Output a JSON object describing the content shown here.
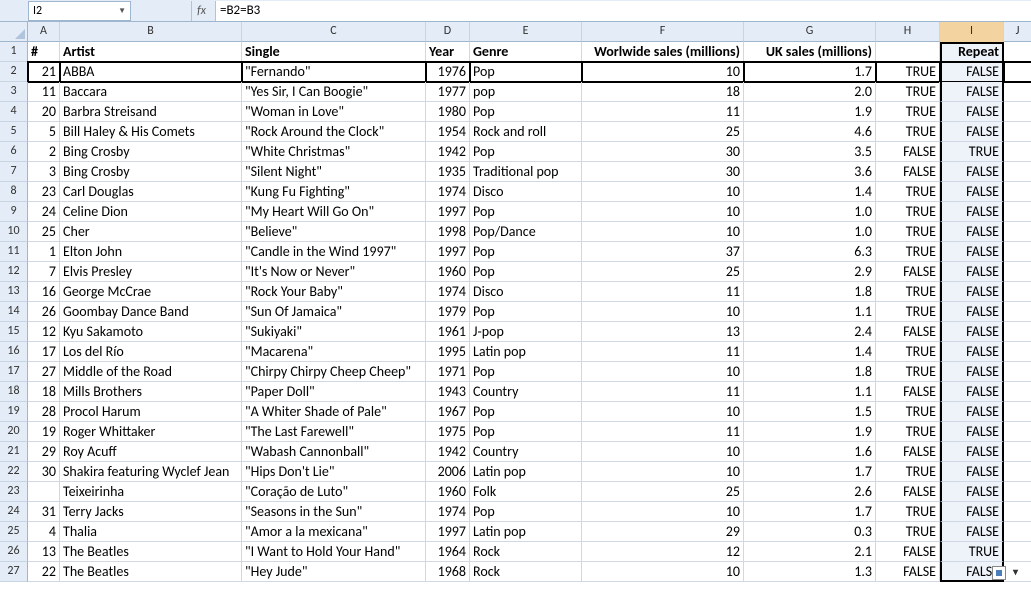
{
  "formula_bar": {
    "name_box": "I2",
    "formula": "=B2=B3"
  },
  "columns": [
    {
      "letter": "A",
      "cls": "col-A"
    },
    {
      "letter": "B",
      "cls": "col-B"
    },
    {
      "letter": "C",
      "cls": "col-C"
    },
    {
      "letter": "D",
      "cls": "col-D"
    },
    {
      "letter": "E",
      "cls": "col-E"
    },
    {
      "letter": "F",
      "cls": "col-F"
    },
    {
      "letter": "G",
      "cls": "col-G"
    },
    {
      "letter": "H",
      "cls": "col-H"
    },
    {
      "letter": "I",
      "cls": "col-I",
      "selected": true
    },
    {
      "letter": "J",
      "cls": "col-J"
    }
  ],
  "headers": {
    "A": "#",
    "B": "Artist",
    "C": "Single",
    "D": "Year",
    "E": "Genre",
    "F": "Worlwide sales (millions)",
    "G": "UK sales (millions)",
    "H": "",
    "I": "Repeat"
  },
  "active_cell": "I2",
  "selected_column": "I",
  "rows": [
    {
      "n": 2,
      "A": "21",
      "B": "ABBA",
      "C": "\"Fernando\"",
      "D": "1976",
      "E": "Pop",
      "F": "10",
      "G": "1.7",
      "H": "TRUE",
      "I": "FALSE"
    },
    {
      "n": 3,
      "A": "11",
      "B": "Baccara",
      "C": "\"Yes Sir, I Can Boogie\"",
      "D": "1977",
      "E": "pop",
      "F": "18",
      "G": "2.0",
      "H": "TRUE",
      "I": "FALSE"
    },
    {
      "n": 4,
      "A": "20",
      "B": "Barbra Streisand",
      "C": "\"Woman in Love\"",
      "D": "1980",
      "E": "Pop",
      "F": "11",
      "G": "1.9",
      "H": "TRUE",
      "I": "FALSE"
    },
    {
      "n": 5,
      "A": "5",
      "B": "Bill Haley & His Comets",
      "C": "\"Rock Around the Clock\"",
      "D": "1954",
      "E": "Rock and roll",
      "F": "25",
      "G": "4.6",
      "H": "TRUE",
      "I": "FALSE"
    },
    {
      "n": 6,
      "A": "2",
      "B": "Bing Crosby",
      "C": "\"White Christmas\"",
      "D": "1942",
      "E": "Pop",
      "F": "30",
      "G": "3.5",
      "H": "FALSE",
      "I": "TRUE"
    },
    {
      "n": 7,
      "A": "3",
      "B": "Bing Crosby",
      "C": "\"Silent Night\"",
      "D": "1935",
      "E": "Traditional pop",
      "F": "30",
      "G": "3.6",
      "H": "FALSE",
      "I": "FALSE"
    },
    {
      "n": 8,
      "A": "23",
      "B": "Carl Douglas",
      "C": "\"Kung Fu Fighting\"",
      "D": "1974",
      "E": "Disco",
      "F": "10",
      "G": "1.4",
      "H": "TRUE",
      "I": "FALSE"
    },
    {
      "n": 9,
      "A": "24",
      "B": "Celine Dion",
      "C": "\"My Heart Will Go On\"",
      "D": "1997",
      "E": "Pop",
      "F": "10",
      "G": "1.0",
      "H": "TRUE",
      "I": "FALSE"
    },
    {
      "n": 10,
      "A": "25",
      "B": "Cher",
      "C": "\"Believe\"",
      "D": "1998",
      "E": "Pop/Dance",
      "F": "10",
      "G": "1.0",
      "H": "TRUE",
      "I": "FALSE"
    },
    {
      "n": 11,
      "A": "1",
      "B": "Elton John",
      "C": "\"Candle in the Wind 1997\"",
      "D": "1997",
      "E": "Pop",
      "F": "37",
      "G": "6.3",
      "H": "TRUE",
      "I": "FALSE"
    },
    {
      "n": 12,
      "A": "7",
      "B": "Elvis Presley",
      "C": "\"It's Now or Never\"",
      "D": "1960",
      "E": "Pop",
      "F": "25",
      "G": "2.9",
      "H": "FALSE",
      "I": "FALSE"
    },
    {
      "n": 13,
      "A": "16",
      "B": "George McCrae",
      "C": "\"Rock Your Baby\"",
      "D": "1974",
      "E": "Disco",
      "F": "11",
      "G": "1.8",
      "H": "TRUE",
      "I": "FALSE"
    },
    {
      "n": 14,
      "A": "26",
      "B": "Goombay Dance Band",
      "C": "\"Sun Of Jamaica\"",
      "D": "1979",
      "E": "Pop",
      "F": "10",
      "G": "1.1",
      "H": "TRUE",
      "I": "FALSE"
    },
    {
      "n": 15,
      "A": "12",
      "B": "Kyu Sakamoto",
      "C": "\"Sukiyaki\"",
      "D": "1961",
      "E": "J-pop",
      "F": "13",
      "G": "2.4",
      "H": "FALSE",
      "I": "FALSE"
    },
    {
      "n": 16,
      "A": "17",
      "B": "Los del Río",
      "C": "\"Macarena\"",
      "D": "1995",
      "E": "Latin pop",
      "F": "11",
      "G": "1.4",
      "H": "TRUE",
      "I": "FALSE"
    },
    {
      "n": 17,
      "A": "27",
      "B": "Middle of the Road",
      "C": "\"Chirpy Chirpy Cheep Cheep\"",
      "D": "1971",
      "E": "Pop",
      "F": "10",
      "G": "1.8",
      "H": "TRUE",
      "I": "FALSE"
    },
    {
      "n": 18,
      "A": "18",
      "B": "Mills Brothers",
      "C": "\"Paper Doll\"",
      "D": "1943",
      "E": "Country",
      "F": "11",
      "G": "1.1",
      "H": "FALSE",
      "I": "FALSE"
    },
    {
      "n": 19,
      "A": "28",
      "B": "Procol Harum",
      "C": "\"A Whiter Shade of Pale\"",
      "D": "1967",
      "E": "Pop",
      "F": "10",
      "G": "1.5",
      "H": "TRUE",
      "I": "FALSE"
    },
    {
      "n": 20,
      "A": "19",
      "B": "Roger Whittaker",
      "C": "\"The Last Farewell\"",
      "D": "1975",
      "E": "Pop",
      "F": "11",
      "G": "1.9",
      "H": "TRUE",
      "I": "FALSE"
    },
    {
      "n": 21,
      "A": "29",
      "B": "Roy Acuff",
      "C": "\"Wabash Cannonball\"",
      "D": "1942",
      "E": "Country",
      "F": "10",
      "G": "1.6",
      "H": "FALSE",
      "I": "FALSE"
    },
    {
      "n": 22,
      "A": "30",
      "B": "Shakira featuring Wyclef Jean",
      "C": "\"Hips Don't Lie\"",
      "D": "2006",
      "E": "Latin pop",
      "F": "10",
      "G": "1.7",
      "H": "TRUE",
      "I": "FALSE"
    },
    {
      "n": 23,
      "A": "",
      "B": "Teixeirinha",
      "C": "\"Coração de Luto\"",
      "D": "1960",
      "E": "Folk",
      "F": "25",
      "G": "2.6",
      "H": "FALSE",
      "I": "FALSE"
    },
    {
      "n": 24,
      "A": "31",
      "B": "Terry Jacks",
      "C": "\"Seasons in the Sun\"",
      "D": "1974",
      "E": "Pop",
      "F": "10",
      "G": "1.7",
      "H": "TRUE",
      "I": "FALSE"
    },
    {
      "n": 25,
      "A": "4",
      "B": "Thalia",
      "C": "\"Amor a la mexicana\"",
      "D": "1997",
      "E": "Latin pop",
      "F": "29",
      "G": "0.3",
      "H": "TRUE",
      "I": "FALSE"
    },
    {
      "n": 26,
      "A": "13",
      "B": "The Beatles",
      "C": "\"I Want to Hold Your Hand\"",
      "D": "1964",
      "E": "Rock",
      "F": "12",
      "G": "2.1",
      "H": "FALSE",
      "I": "TRUE"
    },
    {
      "n": 27,
      "A": "22",
      "B": "The Beatles",
      "C": "\"Hey Jude\"",
      "D": "1968",
      "E": "Rock",
      "F": "10",
      "G": "1.3",
      "H": "FALSE",
      "I": "FALSE"
    }
  ]
}
